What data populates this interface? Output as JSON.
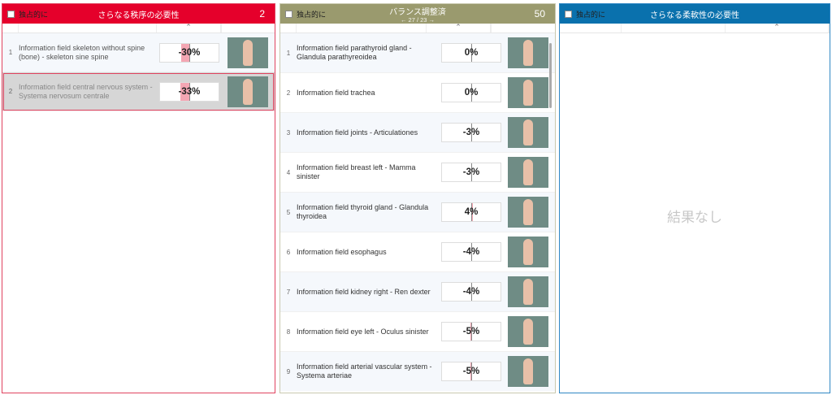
{
  "panels": {
    "red": {
      "exclusive_label": "独占的に",
      "title": "さらなる秩序の必要性",
      "count": "2",
      "rows": [
        {
          "num": "1",
          "name": "Information field skeleton without spine (bone) - skeleton sine spine",
          "value": "-30%",
          "level": -30
        },
        {
          "num": "2",
          "name": "Information field central nervous system - Systema nervosum centrale",
          "value": "-33%",
          "level": -33
        }
      ]
    },
    "olive": {
      "exclusive_label": "独占的に",
      "title": "バランス調整済",
      "subtitle": "← 27 / 23 →",
      "count": "50",
      "rows": [
        {
          "num": "1",
          "name": "Information field parathyroid gland - Glandula parathyreoidea",
          "value": "0%",
          "level": 0
        },
        {
          "num": "2",
          "name": "Information field trachea",
          "value": "0%",
          "level": 0
        },
        {
          "num": "3",
          "name": "Information field joints - Articulationes",
          "value": "-3%",
          "level": -3
        },
        {
          "num": "4",
          "name": "Information field breast left - Mamma sinister",
          "value": "-3%",
          "level": -3
        },
        {
          "num": "5",
          "name": "Information field thyroid gland - Glandula thyroidea",
          "value": "4%",
          "level": 4
        },
        {
          "num": "6",
          "name": "Information field esophagus",
          "value": "-4%",
          "level": -4
        },
        {
          "num": "7",
          "name": "Information field kidney right - Ren dexter",
          "value": "-4%",
          "level": -4
        },
        {
          "num": "8",
          "name": "Information field eye left - Oculus sinister",
          "value": "-5%",
          "level": -5
        },
        {
          "num": "9",
          "name": "Information field arterial vascular system - Systema arteriae",
          "value": "-5%",
          "level": -5
        }
      ]
    },
    "blue": {
      "exclusive_label": "独占的に",
      "title": "さらなる柔軟性の必要性",
      "empty_text": "結果なし"
    }
  },
  "colors": {
    "red_header": "#e5002b",
    "olive_header": "#9a9a6e",
    "blue_header": "#0a71ad",
    "level_bar": "#f4a6b3"
  },
  "icons": {
    "sort": "chevron-up-icon"
  }
}
